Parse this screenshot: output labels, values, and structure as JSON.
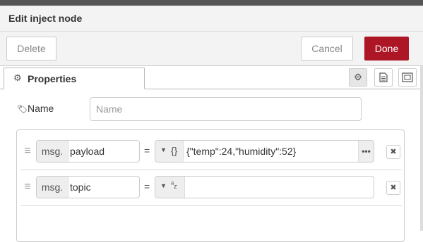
{
  "tray": {
    "title": "Edit inject node"
  },
  "toolbar": {
    "delete_label": "Delete",
    "cancel_label": "Cancel",
    "done_label": "Done"
  },
  "tabs": [
    {
      "label": "Properties",
      "icon": "gear-icon",
      "active": true
    }
  ],
  "tab_icons": [
    "gear-icon",
    "description-icon",
    "appearance-icon"
  ],
  "form": {
    "name_label": "Name",
    "name_placeholder": "Name",
    "name_value": ""
  },
  "props": [
    {
      "prefix": "msg.",
      "property": "payload",
      "equals": "=",
      "type": "json",
      "type_icon": "{}",
      "value": "{\"temp\":24,\"humidity\":52}"
    },
    {
      "prefix": "msg.",
      "property": "topic",
      "equals": "=",
      "type": "str",
      "type_icon": "az",
      "value": ""
    }
  ],
  "colors": {
    "done": "#ad1625",
    "header_bg": "#f3f3f3"
  }
}
